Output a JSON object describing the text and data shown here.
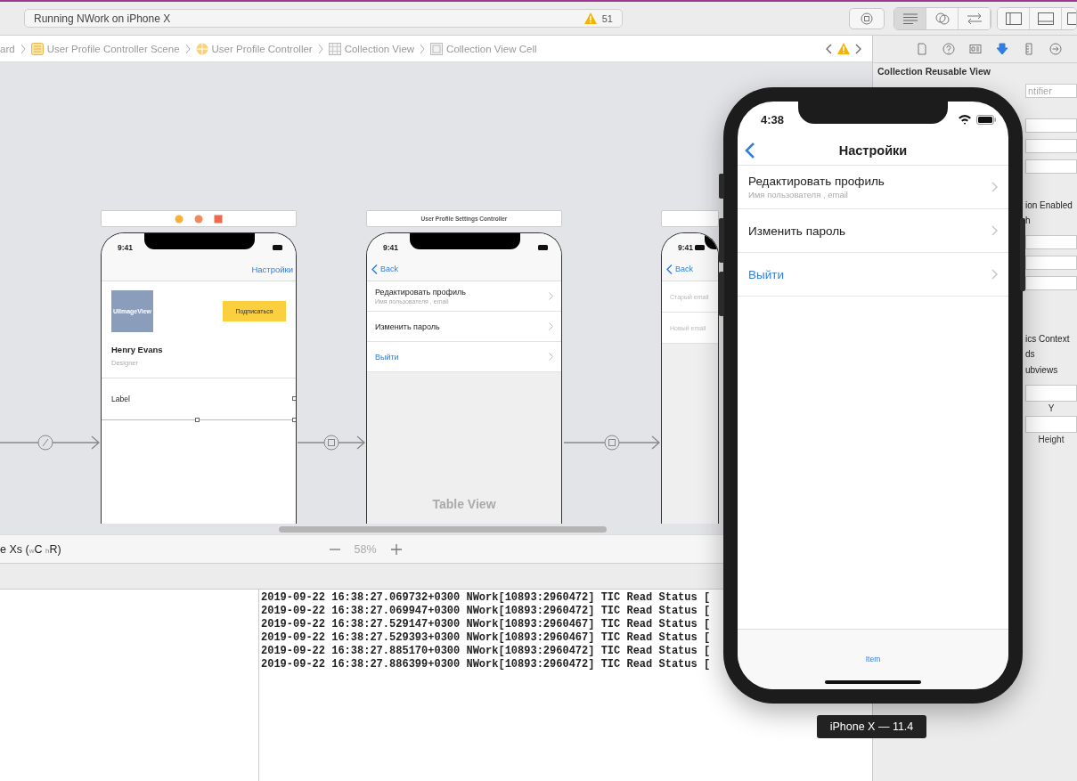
{
  "toolbar": {
    "scheme": "Running NWork on iPhone X",
    "warnings": "51",
    "editor_modes": [
      {
        "selected": true
      },
      {
        "selected": false
      },
      {
        "selected": false
      }
    ]
  },
  "breadcrumbs": [
    "ard",
    "User Profile Controller Scene",
    "User Profile Controller",
    "Collection View",
    "Collection View Cell"
  ],
  "scenes": [
    {
      "kind": "profile",
      "time": "9:41",
      "nav_button": "Настройки",
      "image_label": "UIImageView",
      "follow_button": "Подписаться",
      "name": "Henry Evans",
      "role": "Designer",
      "cell_label": "Label"
    },
    {
      "kind": "settings",
      "title": "User Profile Settings Controller",
      "time": "9:41",
      "back": "Back",
      "rows": [
        {
          "title": "Редактировать профиль",
          "subtitle": "Имя пользователя , email",
          "kind": "normal"
        },
        {
          "title": "Изменить пароль",
          "kind": "normal"
        },
        {
          "title": "Выйти",
          "kind": "action"
        }
      ],
      "table_label": "Table View"
    },
    {
      "kind": "email",
      "time": "9:41",
      "back": "Back",
      "fields": [
        {
          "placeholder": "Старый email"
        },
        {
          "placeholder": "Новый email"
        }
      ]
    }
  ],
  "device_bar": {
    "device": "e Xs ($_{w}$C $_{h}$R)",
    "zoom": "58%"
  },
  "console": {
    "lines": [
      "2019-09-22 16:38:27.069732+0300 NWork[10893:2960472] TIC Read Status [",
      "2019-09-22 16:38:27.069947+0300 NWork[10893:2960472] TIC Read Status [",
      "2019-09-22 16:38:27.529147+0300 NWork[10893:2960467] TIC Read Status [",
      "2019-09-22 16:38:27.529393+0300 NWork[10893:2960467] TIC Read Status [",
      "2019-09-22 16:38:27.885170+0300 NWork[10893:2960472] TIC Read Status [",
      "2019-09-22 16:38:27.886399+0300 NWork[10893:2960472] TIC Read Status ["
    ]
  },
  "inspector": {
    "tabs": [
      {
        "selected": false
      },
      {
        "selected": false
      },
      {
        "selected": false
      },
      {
        "selected": true
      },
      {
        "selected": false
      },
      {
        "selected": false
      }
    ],
    "title": "Collection Reusable View",
    "rows": [
      {
        "kind": "field",
        "placeholder": "ntifier"
      },
      {
        "kind": "field"
      },
      {
        "kind": "field"
      },
      {
        "kind": "field"
      },
      {
        "kind": "label",
        "text": "ion Enabled"
      },
      {
        "kind": "label",
        "text": "h"
      },
      {
        "kind": "field"
      },
      {
        "kind": "field"
      },
      {
        "kind": "field"
      },
      {
        "kind": "label",
        "text": "ics Context"
      },
      {
        "kind": "label",
        "text": "ds"
      },
      {
        "kind": "label",
        "text": "ubviews"
      },
      {
        "kind": "captioned",
        "caption": "Y"
      },
      {
        "kind": "captioned",
        "caption": "Height"
      }
    ]
  },
  "simulator": {
    "time": "4:38",
    "title": "Настройки",
    "rows": [
      {
        "title": "Редактировать профиль",
        "subtitle": "Имя пользователя , email",
        "kind": "normal"
      },
      {
        "title": "Изменить пароль",
        "kind": "normal"
      },
      {
        "title": "Выйти",
        "kind": "action"
      }
    ],
    "tab_item": "Item",
    "label": "iPhone X — 11.4"
  }
}
